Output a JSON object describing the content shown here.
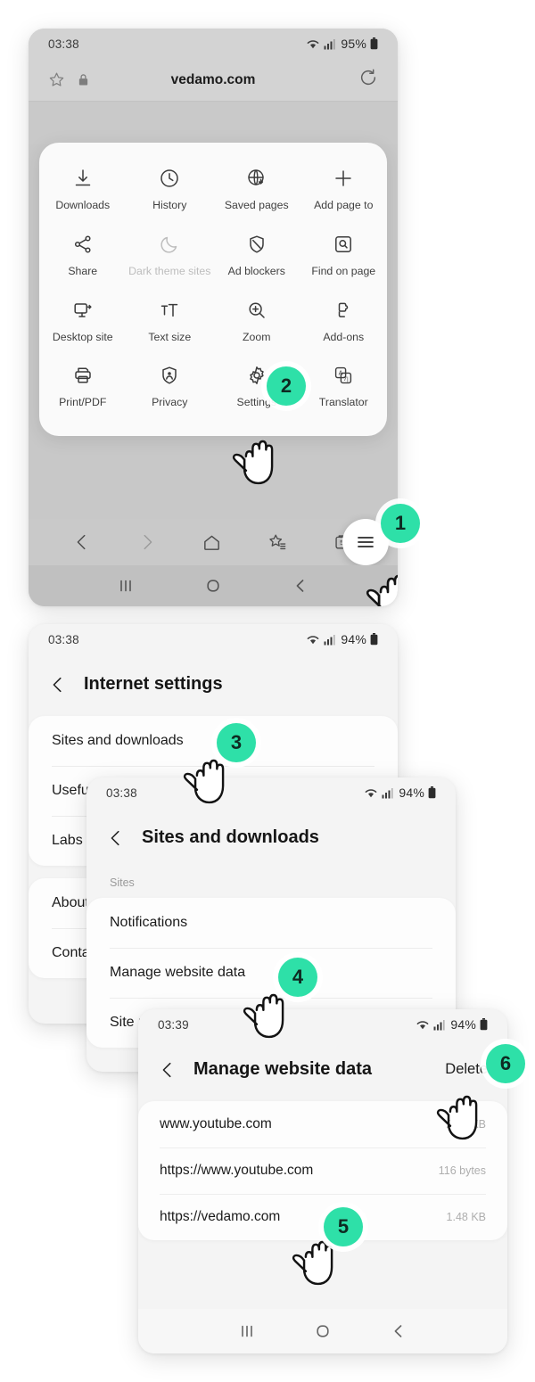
{
  "accent_color": "#2ee0a8",
  "phone1": {
    "status": {
      "time": "03:38",
      "battery": "95%"
    },
    "urlbar": {
      "title": "vedamo.com"
    },
    "menu": {
      "items": [
        {
          "label": "Downloads",
          "icon": "download-icon",
          "disabled": false
        },
        {
          "label": "History",
          "icon": "clock-icon",
          "disabled": false
        },
        {
          "label": "Saved pages",
          "icon": "globe-save-icon",
          "disabled": false
        },
        {
          "label": "Add page to",
          "icon": "plus-icon",
          "disabled": false
        },
        {
          "label": "Share",
          "icon": "share-icon",
          "disabled": false
        },
        {
          "label": "Dark theme sites",
          "icon": "moon-icon",
          "disabled": true
        },
        {
          "label": "Ad blockers",
          "icon": "block-shield-icon",
          "disabled": false
        },
        {
          "label": "Find on page",
          "icon": "find-in-page-icon",
          "disabled": false
        },
        {
          "label": "Desktop site",
          "icon": "monitor-icon",
          "disabled": false
        },
        {
          "label": "Text size",
          "icon": "text-size-icon",
          "disabled": false
        },
        {
          "label": "Zoom",
          "icon": "zoom-in-icon",
          "disabled": false
        },
        {
          "label": "Add-ons",
          "icon": "puzzle-icon",
          "disabled": false
        },
        {
          "label": "Print/PDF",
          "icon": "printer-icon",
          "disabled": false
        },
        {
          "label": "Privacy",
          "icon": "privacy-shield-icon",
          "disabled": false
        },
        {
          "label": "Settings",
          "icon": "gear-icon",
          "disabled": false
        },
        {
          "label": "Translator",
          "icon": "translate-icon",
          "disabled": false
        }
      ]
    },
    "navbar": {
      "back": "back-icon",
      "forward": "forward-icon",
      "home": "home-icon",
      "bookmarks": "bookmarks-icon",
      "tabs": "tabs-icon",
      "tab_count": "5",
      "menu": "hamburger-menu-icon"
    },
    "sysbar": {
      "recents": "recents-icon",
      "home": "home-circle-icon",
      "back": "back-chevron-icon"
    }
  },
  "phone2": {
    "status": {
      "time": "03:38",
      "battery": "94%"
    },
    "title": "Internet settings",
    "back": "back-chevron-icon",
    "group1": [
      {
        "label": "Sites and downloads"
      },
      {
        "label": "Useful features"
      },
      {
        "label": "Labs"
      }
    ],
    "group2": [
      {
        "label": "About Internet"
      },
      {
        "label": "Contact us"
      }
    ]
  },
  "phone3": {
    "status": {
      "time": "03:38",
      "battery": "94%"
    },
    "title": "Sites and downloads",
    "back": "back-chevron-icon",
    "section_label": "Sites",
    "rows": [
      {
        "label": "Notifications"
      },
      {
        "label": "Manage website data"
      },
      {
        "label": "Site permissions"
      }
    ]
  },
  "phone4": {
    "status": {
      "time": "03:39",
      "battery": "94%"
    },
    "title": "Manage website data",
    "back": "back-chevron-icon",
    "action": "Delete",
    "rows": [
      {
        "url": "www.youtube.com",
        "size": "27.9 KB"
      },
      {
        "url": "https://www.youtube.com",
        "size": "116 bytes"
      },
      {
        "url": "https://vedamo.com",
        "size": "1.48 KB"
      }
    ],
    "sysbar": {
      "recents": "recents-icon",
      "home": "home-circle-icon",
      "back": "back-chevron-icon"
    }
  },
  "steps": [
    {
      "n": "1"
    },
    {
      "n": "2"
    },
    {
      "n": "3"
    },
    {
      "n": "4"
    },
    {
      "n": "5"
    },
    {
      "n": "6"
    }
  ]
}
